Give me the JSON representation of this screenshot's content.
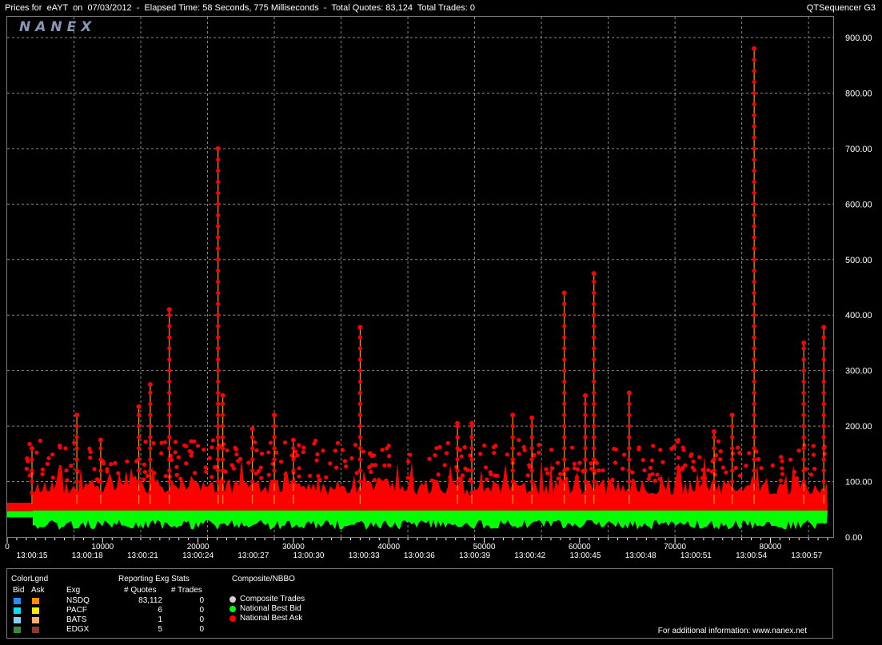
{
  "header": {
    "title": "Prices for  eAYT  on  07/03/2012  -  Elapsed Time: 58 Seconds, 775 Milliseconds  -  Total Quotes: 83,124  Total Trades: 0",
    "app_name": "QTSequencer G3"
  },
  "logo_text": "NANEX",
  "chart_data": {
    "type": "scatter",
    "symbol": "eAYT",
    "date": "07/03/2012",
    "y_ticks": [
      "900.00",
      "800.00",
      "700.00",
      "600.00",
      "500.00",
      "400.00",
      "300.00",
      "200.00",
      "100.00",
      "0.00"
    ],
    "ylim": [
      0,
      900
    ],
    "x_ticks": [
      "0",
      "10000",
      "20000",
      "30000",
      "40000",
      "50000",
      "60000",
      "70000",
      "80000"
    ],
    "xlim": [
      0,
      86000
    ],
    "time_ticks": [
      "13:00:15",
      "13:00:18",
      "13:00:21",
      "13:00:24",
      "13:00:27",
      "13:00:30",
      "13:00:33",
      "13:00:36",
      "13:00:39",
      "13:00:42",
      "13:00:45",
      "13:00:48",
      "13:00:51",
      "13:00:54",
      "13:00:57"
    ],
    "grid": true,
    "series": [
      {
        "name": "National Best Ask",
        "color": "#ff0000",
        "baseline": 60,
        "spikes": [
          {
            "x": 2600,
            "y": 160
          },
          {
            "x": 7300,
            "y": 220
          },
          {
            "x": 9800,
            "y": 175
          },
          {
            "x": 13800,
            "y": 235
          },
          {
            "x": 15000,
            "y": 275
          },
          {
            "x": 17000,
            "y": 410
          },
          {
            "x": 22100,
            "y": 700
          },
          {
            "x": 22600,
            "y": 255
          },
          {
            "x": 25700,
            "y": 195
          },
          {
            "x": 28000,
            "y": 220
          },
          {
            "x": 30000,
            "y": 175
          },
          {
            "x": 37000,
            "y": 378
          },
          {
            "x": 47200,
            "y": 205
          },
          {
            "x": 48700,
            "y": 205
          },
          {
            "x": 53000,
            "y": 220
          },
          {
            "x": 55000,
            "y": 215
          },
          {
            "x": 58400,
            "y": 440
          },
          {
            "x": 61500,
            "y": 475
          },
          {
            "x": 60600,
            "y": 255
          },
          {
            "x": 65200,
            "y": 260
          },
          {
            "x": 74100,
            "y": 190
          },
          {
            "x": 76000,
            "y": 220
          },
          {
            "x": 78300,
            "y": 880
          },
          {
            "x": 83500,
            "y": 350
          },
          {
            "x": 85600,
            "y": 378
          }
        ]
      },
      {
        "name": "National Best Bid",
        "color": "#00ff00",
        "baseline": 45
      }
    ]
  },
  "legend": {
    "color_legend_title": "ColorLgnd",
    "bid_label": "Bid",
    "ask_label": "Ask",
    "exg_col_label": "Exg",
    "stats_title": "Reporting Exg Stats",
    "quotes_label": "# Quotes",
    "trades_label": "# Trades",
    "composite_title": "Composite/NBBO",
    "exchanges": [
      {
        "name": "NSDQ",
        "quotes": "83,112",
        "trades": "0",
        "bid_color": "#1e90ff",
        "ask_color": "#ff8c00"
      },
      {
        "name": "PACF",
        "quotes": "6",
        "trades": "0",
        "bid_color": "#00e5ff",
        "ask_color": "#ffee00"
      },
      {
        "name": "BATS",
        "quotes": "1",
        "trades": "0",
        "bid_color": "#87cefa",
        "ask_color": "#f5b070"
      },
      {
        "name": "EDGX",
        "quotes": "5",
        "trades": "0",
        "bid_color": "#3a8a3a",
        "ask_color": "#8b3a2f"
      }
    ],
    "composite_items": [
      {
        "label": "Composite Trades",
        "color": "#d0d0d0"
      },
      {
        "label": "National Best Bid",
        "color": "#00ff00"
      },
      {
        "label": "National Best Ask",
        "color": "#ff0000"
      }
    ],
    "footer": "For additional information: www.nanex.net"
  }
}
